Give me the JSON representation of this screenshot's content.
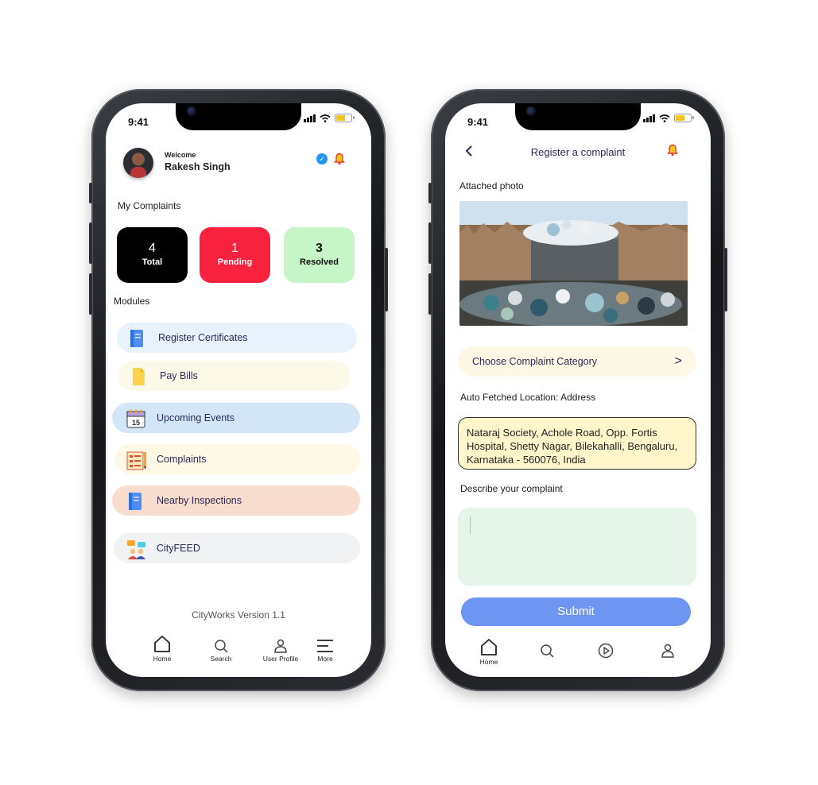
{
  "status_bar": {
    "time": "9:41"
  },
  "home": {
    "welcome": "Welcome",
    "user_name": "Rakesh Singh",
    "my_complaints_title": "My Complaints",
    "stats": [
      {
        "value": "4",
        "label": "Total",
        "color": "#000000"
      },
      {
        "value": "1",
        "label": "Pending",
        "color": "#f8213e"
      },
      {
        "value": "3",
        "label": "Resolved",
        "color": "#c6f5c8"
      }
    ],
    "modules_title": "Modules",
    "modules": [
      {
        "label": "Register Certificates",
        "icon": "book-icon",
        "color": "#e7f2fd"
      },
      {
        "label": "Pay Bills",
        "icon": "document-icon",
        "color": "#fdf9e8"
      },
      {
        "label": "Upcoming Events",
        "icon": "calendar-icon",
        "color": "#d3e6f7"
      },
      {
        "label": "Complaints",
        "icon": "checklist-icon",
        "color": "#fef9e6"
      },
      {
        "label": "Nearby Inspections",
        "icon": "book-icon",
        "color": "#f8dccd"
      },
      {
        "label": "CityFEED",
        "icon": "chat-people-icon",
        "color": "#f1f2f3"
      }
    ],
    "version": "CityWorks Version 1.1",
    "nav": [
      {
        "label": "Home",
        "icon": "home-icon"
      },
      {
        "label": "Search",
        "icon": "search-icon"
      },
      {
        "label": "User Profile",
        "icon": "user-icon"
      },
      {
        "label": "More",
        "icon": "menu-icon"
      }
    ]
  },
  "register": {
    "title": "Register a complaint",
    "attached_photo_label": "Attached photo",
    "category_label": "Choose Complaint Category",
    "category_chevron": ">",
    "location_label": "Auto Fetched Location: Address",
    "address": "Nataraj Society, Achole Road, Opp. Fortis Hospital, Shetty Nagar, Bilekahalli, Bengaluru, Karnataka - 560076, India",
    "describe_label": "Describe your complaint",
    "describe_value": "",
    "submit_label": "Submit",
    "nav": [
      {
        "label": "Home",
        "icon": "home-icon"
      },
      {
        "label": "",
        "icon": "search-icon"
      },
      {
        "label": "",
        "icon": "play-icon"
      },
      {
        "label": "",
        "icon": "user-icon"
      }
    ]
  }
}
